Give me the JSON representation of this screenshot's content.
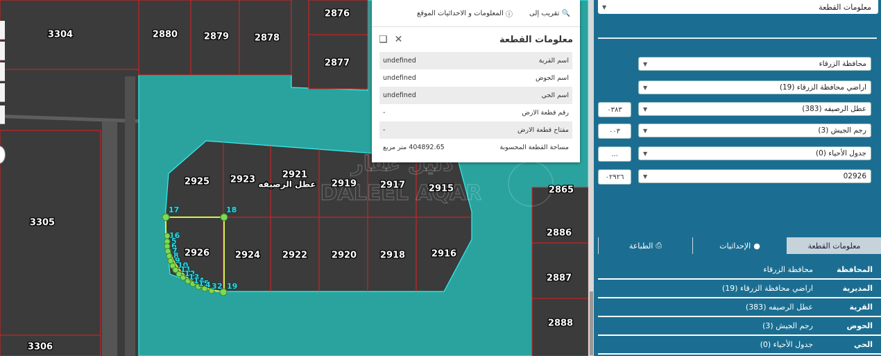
{
  "map": {
    "parcels": [
      {
        "id": "p3304",
        "label": "3304"
      },
      {
        "id": "p2880",
        "label": "2880"
      },
      {
        "id": "p2879",
        "label": "2879"
      },
      {
        "id": "p2878",
        "label": "2878"
      },
      {
        "id": "p2876",
        "label": "2876"
      },
      {
        "id": "p2877",
        "label": "2877"
      },
      {
        "id": "p3305",
        "label": "3305"
      },
      {
        "id": "p3306",
        "label": "3306"
      },
      {
        "id": "p2925",
        "label": "2925"
      },
      {
        "id": "p2923",
        "label": "2923"
      },
      {
        "id": "p2921",
        "label": "2921"
      },
      {
        "id": "p2919",
        "label": "2919"
      },
      {
        "id": "p2917",
        "label": "2917"
      },
      {
        "id": "p2915",
        "label": "2915"
      },
      {
        "id": "p2926",
        "label": "2926"
      },
      {
        "id": "p2924",
        "label": "2924"
      },
      {
        "id": "p2922",
        "label": "2922"
      },
      {
        "id": "p2920",
        "label": "2920"
      },
      {
        "id": "p2918",
        "label": "2918"
      },
      {
        "id": "p2916",
        "label": "2916"
      },
      {
        "id": "p2865",
        "label": "2865"
      },
      {
        "id": "p2886",
        "label": "2886"
      },
      {
        "id": "p2887",
        "label": "2887"
      },
      {
        "id": "p2888",
        "label": "2888"
      }
    ],
    "area_name": "عطل الرصيفه",
    "vertex_labels": [
      "17",
      "18",
      "16",
      "5",
      "6",
      "7",
      "8",
      "9",
      "10",
      "11",
      "12",
      "13",
      "14",
      "15",
      "4",
      "3",
      "2",
      "19"
    ],
    "watermark": {
      "arabic": "دليل عقار",
      "latin": "DALEEL AQAR"
    },
    "colors": {
      "parcel_line": "#e02020",
      "highlight_zone": "#2aa39e",
      "zone_border": "#35f0f0",
      "selection": "#d9f24a",
      "vertex": "#7ed957"
    }
  },
  "popup": {
    "zoom_to": "تقريب إلى",
    "info_coords": "المعلومات و الاحداثيات الموقع",
    "title": "معلومات القطعة",
    "rows": [
      {
        "k": "اسم القرية",
        "v": "undefined"
      },
      {
        "k": "اسم الحوض",
        "v": "undefined"
      },
      {
        "k": "اسم الحي",
        "v": "undefined"
      },
      {
        "k": "رقم قطعة الارض",
        "v": "-"
      },
      {
        "k": "مفتاح قطعة الارض",
        "v": "-"
      },
      {
        "k": "مساحة القطعة المحسوبة",
        "v": "404892.65 متر مربع"
      }
    ]
  },
  "panel": {
    "top_select": "معلومات القطعة",
    "fields": [
      {
        "value": "محافظة الزرقاء",
        "num": ""
      },
      {
        "value": "اراضي محافظة الزرقاء (19)",
        "num": ""
      },
      {
        "value": "عطل الرصيفه (383)",
        "num": "٠٣٨٣"
      },
      {
        "value": "رجم الجيش (3)",
        "num": "٠٠٣"
      },
      {
        "value": "جدول الأحياء (0)",
        "num": "..."
      },
      {
        "value": "02926",
        "num": "٠٢٩٢٦"
      }
    ],
    "tabs": [
      {
        "label": "معلومات القطعة",
        "icon": ""
      },
      {
        "label": "الإحداثيات",
        "icon": "pin-icon"
      },
      {
        "label": "الطباعة",
        "icon": "print-icon"
      }
    ],
    "info": [
      {
        "k": "المحافظة",
        "v": "محافظة الزرقاء"
      },
      {
        "k": "المديرية",
        "v": "اراضي محافظة الزرقاء (19)"
      },
      {
        "k": "القرية",
        "v": "عطل الرصيفه (383)"
      },
      {
        "k": "الحوض",
        "v": "رجم الجيش (3)"
      },
      {
        "k": "الحي",
        "v": "جدول الأحياء (0)"
      }
    ]
  }
}
